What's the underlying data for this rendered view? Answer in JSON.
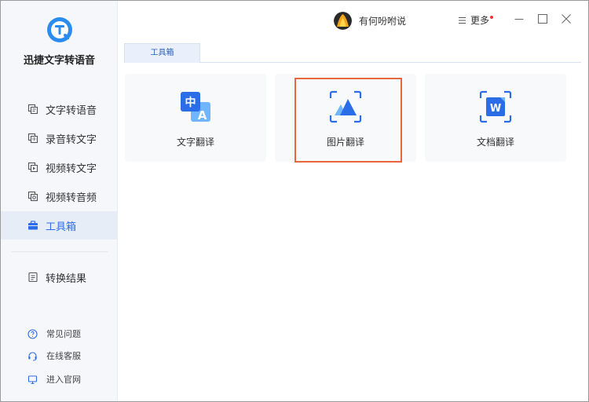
{
  "app": {
    "name": "迅捷文字转语音"
  },
  "sidebar": {
    "items": [
      {
        "label": "文字转语音",
        "icon": "text-to-speech-icon"
      },
      {
        "label": "录音转文字",
        "icon": "recording-to-text-icon"
      },
      {
        "label": "视频转文字",
        "icon": "video-to-text-icon"
      },
      {
        "label": "视频转音频",
        "icon": "video-to-audio-icon"
      },
      {
        "label": "工具箱",
        "icon": "toolbox-icon",
        "active": true
      },
      {
        "label": "转换结果",
        "icon": "results-icon"
      }
    ],
    "footer": [
      {
        "label": "常见问题",
        "icon": "question-icon"
      },
      {
        "label": "在线客服",
        "icon": "headset-icon"
      },
      {
        "label": "进入官网",
        "icon": "monitor-icon"
      }
    ]
  },
  "titlebar": {
    "username": "有何吩咐说",
    "more_label": "更多"
  },
  "tabs": [
    {
      "label": "工具箱",
      "active": true
    }
  ],
  "tools": [
    {
      "label": "文字翻译",
      "icon": "text-translate-icon"
    },
    {
      "label": "图片翻译",
      "icon": "image-translate-icon",
      "highlighted": true
    },
    {
      "label": "文档翻译",
      "icon": "document-translate-icon"
    }
  ],
  "colors": {
    "accent": "#2b6de8",
    "highlight_border": "#e8673a",
    "notification_dot": "#e8383d"
  }
}
